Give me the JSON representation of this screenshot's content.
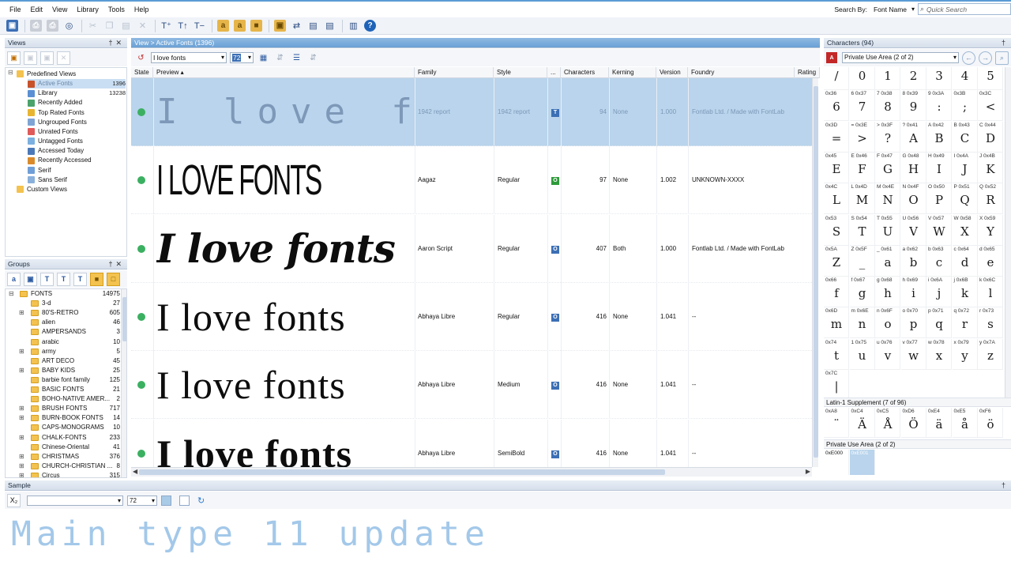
{
  "menu": [
    "File",
    "Edit",
    "View",
    "Library",
    "Tools",
    "Help"
  ],
  "search": {
    "label": "Search By:",
    "field": "Font Name",
    "placeholder": "Quick Search"
  },
  "views": {
    "title": "Views",
    "tree": [
      {
        "label": "Predefined Views",
        "count": "",
        "level": 0
      },
      {
        "label": "Active Fonts",
        "count": "1396",
        "level": 1,
        "selected": true
      },
      {
        "label": "Library",
        "count": "13238",
        "level": 1
      },
      {
        "label": "Recently Added",
        "count": "",
        "level": 1
      },
      {
        "label": "Top Rated Fonts",
        "count": "",
        "level": 1
      },
      {
        "label": "Ungrouped Fonts",
        "count": "",
        "level": 1
      },
      {
        "label": "Unrated Fonts",
        "count": "",
        "level": 1
      },
      {
        "label": "Untagged Fonts",
        "count": "",
        "level": 1
      },
      {
        "label": "Accessed Today",
        "count": "",
        "level": 1
      },
      {
        "label": "Recently Accessed",
        "count": "",
        "level": 1
      },
      {
        "label": "Serif",
        "count": "",
        "level": 1
      },
      {
        "label": "Sans Serif",
        "count": "",
        "level": 1
      },
      {
        "label": "Custom Views",
        "count": "",
        "level": 0
      }
    ]
  },
  "groups": {
    "title": "Groups",
    "root": {
      "label": "FONTS",
      "count": "14975"
    },
    "items": [
      {
        "label": "3-d",
        "count": "27",
        "plus": false
      },
      {
        "label": "80'S-RETRO",
        "count": "605",
        "plus": true
      },
      {
        "label": "alien",
        "count": "46",
        "plus": false
      },
      {
        "label": "AMPERSANDS",
        "count": "3",
        "plus": false
      },
      {
        "label": "arabic",
        "count": "10",
        "plus": false
      },
      {
        "label": "army",
        "count": "5",
        "plus": true
      },
      {
        "label": "ART DECO",
        "count": "45",
        "plus": false
      },
      {
        "label": "BABY KIDS",
        "count": "25",
        "plus": true
      },
      {
        "label": "barbie font family",
        "count": "125",
        "plus": false
      },
      {
        "label": "BASIC FONTS",
        "count": "21",
        "plus": false
      },
      {
        "label": "BOHO-NATIVE AMER...",
        "count": "2",
        "plus": false
      },
      {
        "label": "BRUSH FONTS",
        "count": "717",
        "plus": true
      },
      {
        "label": "BURN-BOOK FONTS",
        "count": "14",
        "plus": true
      },
      {
        "label": "CAPS-MONOGRAMS",
        "count": "10",
        "plus": false
      },
      {
        "label": "CHALK-FONTS",
        "count": "233",
        "plus": true
      },
      {
        "label": "Chinese-Oriental",
        "count": "41",
        "plus": false
      },
      {
        "label": "CHRISTMAS",
        "count": "376",
        "plus": true
      },
      {
        "label": "CHURCH-CHRISTIAN ...",
        "count": "8",
        "plus": true
      },
      {
        "label": "Circus",
        "count": "315",
        "plus": true
      }
    ]
  },
  "main": {
    "breadcrumb": "View > Active Fonts (1396)",
    "preview_text": "I love fonts",
    "size": "72",
    "columns": [
      "State",
      "Preview ▴",
      "Family",
      "Style",
      "...",
      "Characters",
      "Kerning",
      "Version",
      "Foundry",
      "Rating"
    ],
    "rows": [
      {
        "preview": "I love f",
        "family": "1942 report",
        "style": "1942 report",
        "type": "T",
        "chars": "94",
        "kerning": "None",
        "version": "1.000",
        "foundry": "Fontlab Ltd. / Made with FontLab",
        "selected": true
      },
      {
        "preview": "I LOVE FONTS",
        "family": "Aagaz",
        "style": "Regular",
        "type": "O",
        "chars": "97",
        "kerning": "None",
        "version": "1.002",
        "foundry": "UNKNOWN-XXXX",
        "selected": false
      },
      {
        "preview": "I love fonts",
        "family": "Aaron Script",
        "style": "Regular",
        "type": "O",
        "chars": "407",
        "kerning": "Both",
        "version": "1.000",
        "foundry": "Fontlab Ltd. / Made with FontLab",
        "selected": false
      },
      {
        "preview": "I love fonts",
        "family": "Abhaya Libre",
        "style": "Regular",
        "type": "O",
        "chars": "416",
        "kerning": "None",
        "version": "1.041",
        "foundry": "--",
        "selected": false
      },
      {
        "preview": "I love fonts",
        "family": "Abhaya Libre",
        "style": "Medium",
        "type": "O",
        "chars": "416",
        "kerning": "None",
        "version": "1.041",
        "foundry": "--",
        "selected": false
      },
      {
        "preview": "I love fonts",
        "family": "Abhaya Libre",
        "style": "SemiBold",
        "type": "O",
        "chars": "416",
        "kerning": "None",
        "version": "1.041",
        "foundry": "--",
        "selected": false
      }
    ]
  },
  "characters": {
    "title": "Characters (94)",
    "range": "Private Use Area (2 of 2)",
    "cells": [
      [
        "",
        "/"
      ],
      [
        "",
        "0"
      ],
      [
        "",
        "1"
      ],
      [
        "",
        "2"
      ],
      [
        "",
        "3"
      ],
      [
        "",
        "4"
      ],
      [
        "",
        "5"
      ],
      [
        "0x36",
        "6"
      ],
      [
        "6 0x37",
        "7"
      ],
      [
        "7 0x38",
        "8"
      ],
      [
        "8 0x39",
        "9"
      ],
      [
        "9 0x3A",
        ":"
      ],
      [
        "0x3B",
        ";"
      ],
      [
        "0x3C",
        "<"
      ],
      [
        "0x3D",
        "="
      ],
      [
        "= 0x3E",
        ">"
      ],
      [
        "> 0x3F",
        "?"
      ],
      [
        "? 0x41",
        "A"
      ],
      [
        "A 0x42",
        "B"
      ],
      [
        "B 0x43",
        "C"
      ],
      [
        "C 0x44",
        "D"
      ],
      [
        "0x45",
        "E"
      ],
      [
        "E 0x46",
        "F"
      ],
      [
        "F 0x47",
        "G"
      ],
      [
        "G 0x48",
        "H"
      ],
      [
        "H 0x49",
        "I"
      ],
      [
        "I 0x4A",
        "J"
      ],
      [
        "J 0x4B",
        "K"
      ],
      [
        "0x4C",
        "L"
      ],
      [
        "L 0x4D",
        "M"
      ],
      [
        "M 0x4E",
        "N"
      ],
      [
        "N 0x4F",
        "O"
      ],
      [
        "O 0x50",
        "P"
      ],
      [
        "P 0x51",
        "Q"
      ],
      [
        "Q 0x52",
        "R"
      ],
      [
        "0x53",
        "S"
      ],
      [
        "S 0x54",
        "T"
      ],
      [
        "T 0x55",
        "U"
      ],
      [
        "U 0x56",
        "V"
      ],
      [
        "V 0x57",
        "W"
      ],
      [
        "W 0x58",
        "X"
      ],
      [
        "X 0x59",
        "Y"
      ],
      [
        "0x5A",
        "Z"
      ],
      [
        "Z 0x5F",
        "_"
      ],
      [
        "_ 0x61",
        "a"
      ],
      [
        "a 0x62",
        "b"
      ],
      [
        "b 0x63",
        "c"
      ],
      [
        "c 0x64",
        "d"
      ],
      [
        "d 0x65",
        "e"
      ],
      [
        "0x66",
        "f"
      ],
      [
        "f 0x67",
        "g"
      ],
      [
        "g 0x68",
        "h"
      ],
      [
        "h 0x69",
        "i"
      ],
      [
        "i 0x6A",
        "j"
      ],
      [
        "j 0x6B",
        "k"
      ],
      [
        "k 0x6C",
        "l"
      ],
      [
        "0x6D",
        "m"
      ],
      [
        "m 0x6E",
        "n"
      ],
      [
        "n 0x6F",
        "o"
      ],
      [
        "o 0x70",
        "p"
      ],
      [
        "p 0x71",
        "q"
      ],
      [
        "q 0x72",
        "r"
      ],
      [
        "r 0x73",
        "s"
      ],
      [
        "0x74",
        "t"
      ],
      [
        "1 0x75",
        "u"
      ],
      [
        "u 0x76",
        "v"
      ],
      [
        "v 0x77",
        "w"
      ],
      [
        "w 0x78",
        "x"
      ],
      [
        "x 0x79",
        "y"
      ],
      [
        "y 0x7A",
        "z"
      ],
      [
        "0x7C",
        "|"
      ]
    ],
    "latin_label": "Latin-1 Supplement (7 of 96)",
    "latin_cells": [
      [
        "0xA8",
        "¨"
      ],
      [
        "0xC4",
        "Ä"
      ],
      [
        "0xC5",
        "Å"
      ],
      [
        "0xD6",
        "Ö"
      ],
      [
        "0xE4",
        "ä"
      ],
      [
        "0xE5",
        "å"
      ],
      [
        "0xF6",
        "ö"
      ]
    ],
    "pua_label": "Private Use Area (2 of 2)",
    "pua_cells": [
      "0xE000",
      "0xE001"
    ]
  },
  "sample": {
    "title": "Sample",
    "size": "72",
    "text": "Main type 11 update"
  }
}
